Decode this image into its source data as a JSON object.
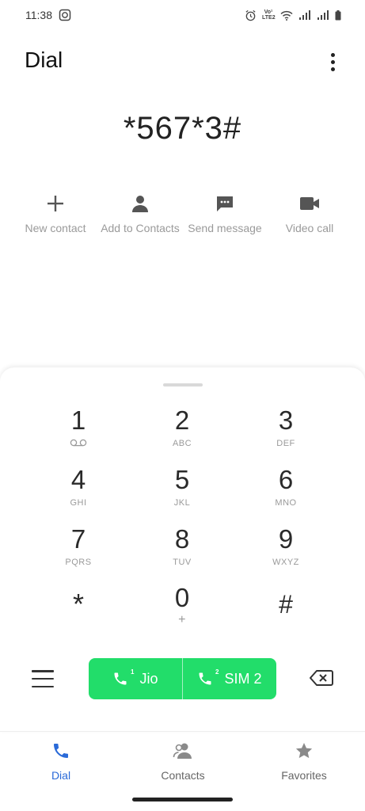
{
  "status_bar": {
    "time": "11:38",
    "volte_top": "Vo¹",
    "volte_bottom": "LTE2"
  },
  "header": {
    "title": "Dial"
  },
  "dialer": {
    "number": "*567*3#"
  },
  "actions": [
    {
      "label": "New contact",
      "icon": "plus-icon"
    },
    {
      "label": "Add to Contacts",
      "icon": "person-icon"
    },
    {
      "label": "Send message",
      "icon": "message-icon"
    },
    {
      "label": "Video call",
      "icon": "video-icon"
    }
  ],
  "keypad": [
    {
      "digit": "1",
      "letters": ""
    },
    {
      "digit": "2",
      "letters": "ABC"
    },
    {
      "digit": "3",
      "letters": "DEF"
    },
    {
      "digit": "4",
      "letters": "GHI"
    },
    {
      "digit": "5",
      "letters": "JKL"
    },
    {
      "digit": "6",
      "letters": "MNO"
    },
    {
      "digit": "7",
      "letters": "PQRS"
    },
    {
      "digit": "8",
      "letters": "TUV"
    },
    {
      "digit": "9",
      "letters": "WXYZ"
    },
    {
      "digit": "*",
      "letters": ""
    },
    {
      "digit": "0",
      "letters": "+"
    },
    {
      "digit": "#",
      "letters": ""
    }
  ],
  "call_buttons": [
    {
      "label": "Jio",
      "sim": "1"
    },
    {
      "label": "SIM 2",
      "sim": "2"
    }
  ],
  "nav": [
    {
      "label": "Dial",
      "active": true
    },
    {
      "label": "Contacts",
      "active": false
    },
    {
      "label": "Favorites",
      "active": false
    }
  ],
  "colors": {
    "call_green": "#22dd6a",
    "active_blue": "#2a6ad8",
    "secondary_text": "#9a9a9a"
  }
}
